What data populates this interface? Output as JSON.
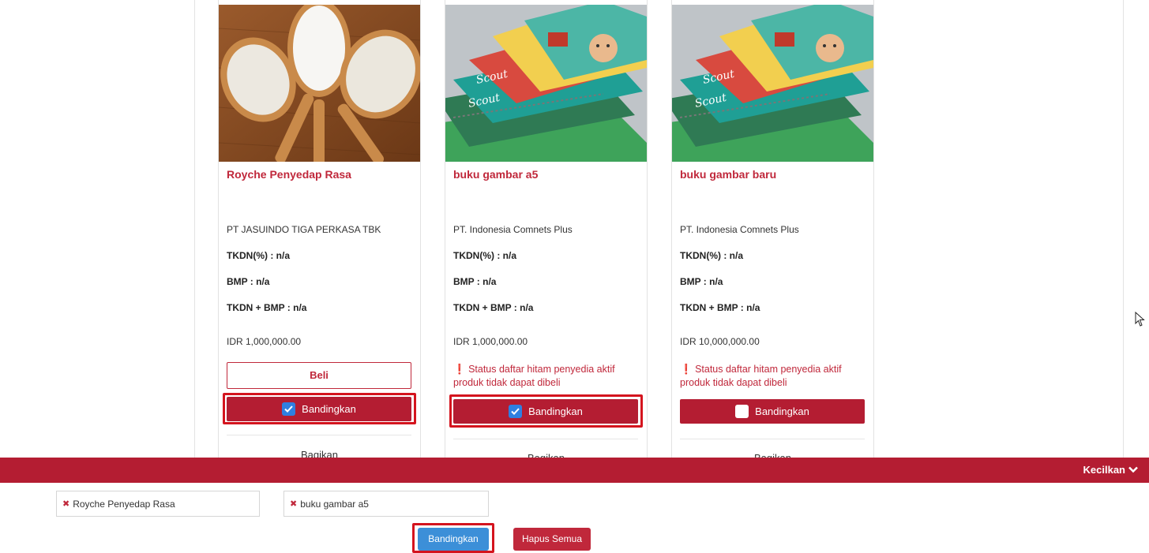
{
  "products": [
    {
      "title": "Royche Penyedap Rasa",
      "vendor": "PT JASUINDO TIGA PERKASA TBK",
      "tkdn": "TKDN(%) : n/a",
      "bmp": "BMP : n/a",
      "tkdn_bmp": "TKDN + BMP : n/a",
      "price": "IDR 1,000,000.00",
      "buy_label": "Beli",
      "compare_label": "Bandingkan",
      "compare_checked": true,
      "share_label": "Bagikan"
    },
    {
      "title": "buku gambar a5",
      "vendor": "PT. Indonesia Comnets Plus",
      "tkdn": "TKDN(%) : n/a",
      "bmp": "BMP : n/a",
      "tkdn_bmp": "TKDN + BMP : n/a",
      "price": "IDR 1,000,000.00",
      "warning": "Status daftar hitam penyedia aktif produk tidak dapat dibeli",
      "compare_label": "Bandingkan",
      "compare_checked": true,
      "share_label": "Bagikan"
    },
    {
      "title": "buku gambar baru",
      "vendor": "PT. Indonesia Comnets Plus",
      "tkdn": "TKDN(%) : n/a",
      "bmp": "BMP : n/a",
      "tkdn_bmp": "TKDN + BMP : n/a",
      "price": "IDR 10,000,000.00",
      "warning": "Status daftar hitam penyedia aktif produk tidak dapat dibeli",
      "compare_label": "Bandingkan",
      "compare_checked": false,
      "share_label": "Bagikan"
    }
  ],
  "compare_bar": {
    "shrink_label": "Kecilkan",
    "selected": [
      "Royche Penyedap Rasa",
      "buku gambar a5"
    ],
    "compare_button": "Bandingkan",
    "clear_button": "Hapus Semua"
  },
  "colors": {
    "brand_red": "#b41d32",
    "title_red": "#c0283b",
    "compare_blue": "#3c8fd8",
    "check_blue": "#2f7fe1",
    "highlight": "#d4141e"
  }
}
